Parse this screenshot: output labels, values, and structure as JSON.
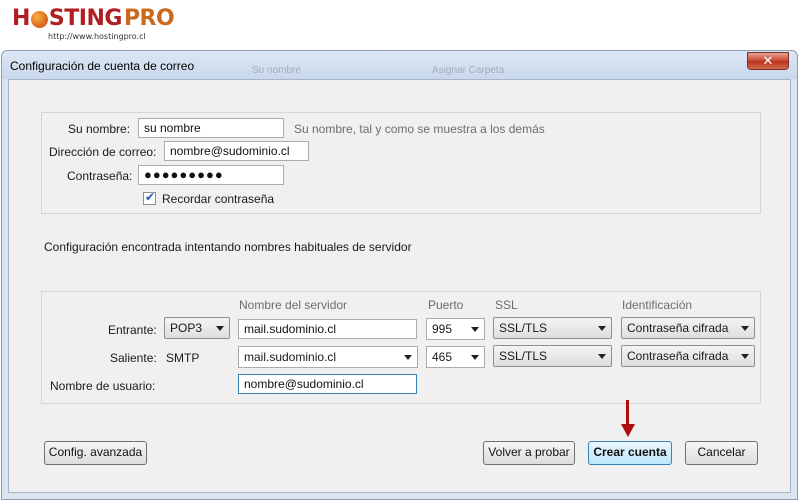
{
  "logo": {
    "text_prefix": "H",
    "text_main": "STING",
    "text_suffix": "PRO",
    "url": "http://www.hostingpro.cl"
  },
  "window": {
    "title": "Configuración de cuenta de correo",
    "ghost_text_1": "Su nombre",
    "ghost_text_2": "Asignar Carpeta",
    "close_symbol": "✕"
  },
  "account": {
    "name_label": "Su nombre:",
    "name_value": "su nombre",
    "name_hint": "Su nombre, tal y como se muestra a los demás",
    "email_label": "Dirección de correo:",
    "email_value": "nombre@sudominio.cl",
    "password_label": "Contraseña:",
    "password_value": "●●●●●●●●●",
    "remember_label": "Recordar contraseña",
    "remember_checked": true
  },
  "status_message": "Configuración encontrada intentando nombres habituales de servidor",
  "server": {
    "headers": {
      "server_name": "Nombre del servidor",
      "port": "Puerto",
      "ssl": "SSL",
      "auth": "Identificación"
    },
    "incoming": {
      "label": "Entrante:",
      "protocol": "POP3",
      "server": "mail.sudominio.cl",
      "port": "995",
      "ssl": "SSL/TLS",
      "auth": "Contraseña cifrada"
    },
    "outgoing": {
      "label": "Saliente:",
      "protocol": "SMTP",
      "server": "mail.sudominio.cl",
      "port": "465",
      "ssl": "SSL/TLS",
      "auth": "Contraseña cifrada"
    },
    "username_label": "Nombre de usuario:",
    "username_value": "nombre@sudominio.cl"
  },
  "buttons": {
    "advanced": "Config. avanzada",
    "retest": "Volver a probar",
    "create": "Crear cuenta",
    "cancel": "Cancelar"
  },
  "colors": {
    "accent_arrow": "#b00d0d",
    "logo_red": "#b01e22",
    "primary_button_border": "#3c7fb1"
  }
}
